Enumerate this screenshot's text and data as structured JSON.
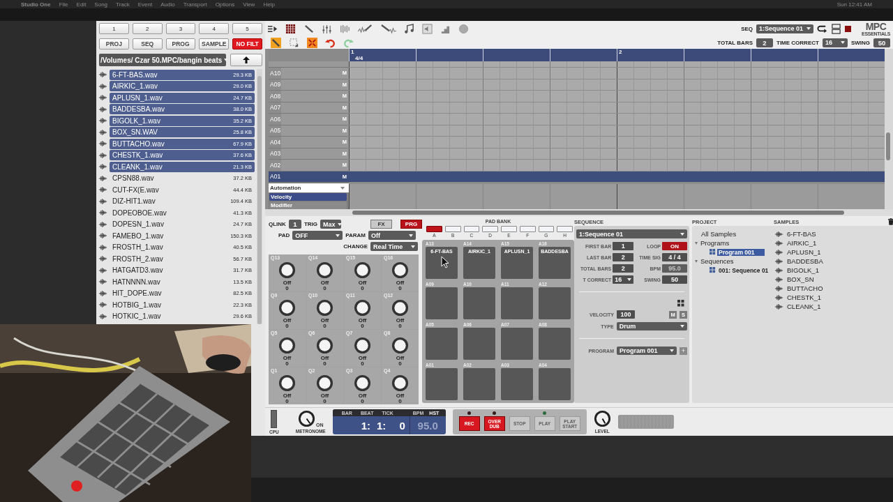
{
  "menubar": {
    "items": [
      "Studio One",
      "File",
      "Edit",
      "Song",
      "Track",
      "Event",
      "Audio",
      "Transport",
      "Options",
      "View",
      "Help"
    ],
    "clock": "Sun 12:41 AM"
  },
  "bank_buttons": [
    "1",
    "2",
    "3",
    "4",
    "5"
  ],
  "mode_buttons": [
    {
      "label": "PROJ",
      "on": false
    },
    {
      "label": "SEQ",
      "on": false
    },
    {
      "label": "PROG",
      "on": false
    },
    {
      "label": "SAMPLE",
      "on": false
    },
    {
      "label": "NO FILT",
      "on": true
    }
  ],
  "browser": {
    "path": "/Volumes/ Czar 50.MPC/bangin beats",
    "files": [
      {
        "name": "6-FT-BAS.wav",
        "size": "29.3 KB",
        "selected": true
      },
      {
        "name": "AIRKIC_1.wav",
        "size": "29.0 KB",
        "selected": true
      },
      {
        "name": "APLUSN_1.wav",
        "size": "24.7 KB",
        "selected": true
      },
      {
        "name": "BADDESBA.wav",
        "size": "38.0 KB",
        "selected": true
      },
      {
        "name": "BIGOLK_1.wav",
        "size": "35.2 KB",
        "selected": true
      },
      {
        "name": "BOX_SN.WAV",
        "size": "25.8 KB",
        "selected": true
      },
      {
        "name": "BUTTACHO.wav",
        "size": "67.9 KB",
        "selected": true
      },
      {
        "name": "CHESTK_1.wav",
        "size": "37.6 KB",
        "selected": true
      },
      {
        "name": "CLEANK_1.wav",
        "size": "21.3 KB",
        "selected": true
      },
      {
        "name": "CPSN88.wav",
        "size": "37.2 KB",
        "selected": false
      },
      {
        "name": "CUT-FX(E.wav",
        "size": "44.4 KB",
        "selected": false
      },
      {
        "name": "DIZ-HIT1.wav",
        "size": "109.4 KB",
        "selected": false
      },
      {
        "name": "DOPEOBOE.wav",
        "size": "41.3 KB",
        "selected": false
      },
      {
        "name": "DOPESN_1.wav",
        "size": "24.7 KB",
        "selected": false
      },
      {
        "name": "FAMEBO_1.wav",
        "size": "150.3 KB",
        "selected": false
      },
      {
        "name": "FROSTH_1.wav",
        "size": "40.5 KB",
        "selected": false
      },
      {
        "name": "FROSTH_2.wav",
        "size": "56.7 KB",
        "selected": false
      },
      {
        "name": "HATGATD3.wav",
        "size": "31.7 KB",
        "selected": false
      },
      {
        "name": "HATNNNN.wav",
        "size": "13.5 KB",
        "selected": false
      },
      {
        "name": "HIT_DOPE.wav",
        "size": "82.5 KB",
        "selected": false
      },
      {
        "name": "HOTBIG_1.wav",
        "size": "22.3 KB",
        "selected": false
      },
      {
        "name": "HOTKIC_1.wav",
        "size": "29.6 KB",
        "selected": false
      }
    ]
  },
  "toolbar": {
    "seq_label": "SEQ",
    "sequence": "1:Sequence 01",
    "logo_title": "MPC",
    "logo_subtitle": "ESSENTIALS",
    "total_bars_label": "TOTAL BARS",
    "total_bars": "2",
    "time_correct_label": "TIME CORRECT",
    "time_correct": "16",
    "swing_label": "SWING",
    "swing": "50"
  },
  "ruler": [
    {
      "bar": "1",
      "time_sig": "4/4"
    },
    {
      "bar": "2"
    }
  ],
  "tracks": [
    {
      "name": "A10",
      "mute": "M",
      "selected": false
    },
    {
      "name": "A09",
      "mute": "M",
      "selected": false
    },
    {
      "name": "A08",
      "mute": "M",
      "selected": false
    },
    {
      "name": "A07",
      "mute": "M",
      "selected": false
    },
    {
      "name": "A06",
      "mute": "M",
      "selected": false
    },
    {
      "name": "A05",
      "mute": "M",
      "selected": false
    },
    {
      "name": "A04",
      "mute": "M",
      "selected": false
    },
    {
      "name": "A03",
      "mute": "M",
      "selected": false
    },
    {
      "name": "A02",
      "mute": "M",
      "selected": false
    },
    {
      "name": "A01",
      "mute": "M",
      "selected": true
    }
  ],
  "automation": {
    "label": "Automation",
    "lanes": [
      {
        "label": "Velocity",
        "selected": true
      },
      {
        "label": "Modifier",
        "selected": false
      }
    ]
  },
  "qlink": {
    "qlink_label": "QLINK",
    "qlink": "1",
    "trig_label": "TRIG",
    "trig": "Max",
    "pad_label": "PAD",
    "pad": "OFF",
    "fx": {
      "label": "FX",
      "on": false
    },
    "prg": {
      "label": "PRG",
      "on": true
    },
    "param_label": "PARAM",
    "param": "Off",
    "change_label": "CHANGE",
    "change": "Real Time",
    "knobs": [
      {
        "name": "Q13",
        "value": "Off",
        "number": "0"
      },
      {
        "name": "Q14",
        "value": "Off",
        "number": "0"
      },
      {
        "name": "Q15",
        "value": "Off",
        "number": "0"
      },
      {
        "name": "Q16",
        "value": "Off",
        "number": "0"
      },
      {
        "name": "Q9",
        "value": "Off",
        "number": "0"
      },
      {
        "name": "Q10",
        "value": "Off",
        "number": "0"
      },
      {
        "name": "Q11",
        "value": "Off",
        "number": "0"
      },
      {
        "name": "Q12",
        "value": "Off",
        "number": "0"
      },
      {
        "name": "Q5",
        "value": "Off",
        "number": "0"
      },
      {
        "name": "Q6",
        "value": "Off",
        "number": "0"
      },
      {
        "name": "Q7",
        "value": "Off",
        "number": "0"
      },
      {
        "name": "Q8",
        "value": "Off",
        "number": "0"
      },
      {
        "name": "Q1",
        "value": "Off",
        "number": "0"
      },
      {
        "name": "Q2",
        "value": "Off",
        "number": "0"
      },
      {
        "name": "Q3",
        "value": "Off",
        "number": "0"
      },
      {
        "name": "Q4",
        "value": "Off",
        "number": "0"
      }
    ]
  },
  "pad_bank": {
    "title": "PAD BANK",
    "banks": [
      {
        "letter": "A",
        "selected": true
      },
      {
        "letter": "B",
        "selected": false
      },
      {
        "letter": "C",
        "selected": false
      },
      {
        "letter": "D",
        "selected": false
      },
      {
        "letter": "E",
        "selected": false
      },
      {
        "letter": "F",
        "selected": false
      },
      {
        "letter": "G",
        "selected": false
      },
      {
        "letter": "H",
        "selected": false
      }
    ],
    "pads": [
      {
        "name": "A13",
        "sample": "6-FT-BAS"
      },
      {
        "name": "A14",
        "sample": "AIRKIC_1"
      },
      {
        "name": "A15",
        "sample": "APLUSN_1"
      },
      {
        "name": "A16",
        "sample": "BADDESBA"
      },
      {
        "name": "A09"
      },
      {
        "name": "A10"
      },
      {
        "name": "A11"
      },
      {
        "name": "A12"
      },
      {
        "name": "A05"
      },
      {
        "name": "A06"
      },
      {
        "name": "A07"
      },
      {
        "name": "A08"
      },
      {
        "name": "A01"
      },
      {
        "name": "A02"
      },
      {
        "name": "A03"
      },
      {
        "name": "A04"
      }
    ]
  },
  "sequence": {
    "title": "SEQUENCE",
    "name": "1:Sequence 01",
    "fields": [
      {
        "label": "FIRST BAR",
        "value": "1",
        "kind": "value"
      },
      {
        "label": "LOOP",
        "value": "ON",
        "kind": "toggle"
      },
      {
        "label": "LAST BAR",
        "value": "2",
        "kind": "value"
      },
      {
        "label": "TIME SIG",
        "value": "4 / 4",
        "kind": "value"
      },
      {
        "label": "TOTAL BARS",
        "value": "2",
        "kind": "value"
      },
      {
        "label": "BPM",
        "value": "95.0",
        "kind": "disabled"
      },
      {
        "label": "T CORRECT",
        "value": "16",
        "kind": "select"
      },
      {
        "label": "SWING",
        "value": "50",
        "kind": "value"
      }
    ],
    "velocity_label": "VELOCITY",
    "velocity": "100",
    "mute": "M",
    "solo": "S",
    "type_label": "TYPE",
    "type": "Drum",
    "program_label": "PROGRAM",
    "program": "Program 001",
    "add": "+"
  },
  "project": {
    "title": "PROJECT",
    "tree": [
      {
        "label": "All Samples",
        "selected": false
      },
      {
        "label": "Programs",
        "expanded": true,
        "selected": false,
        "children": [
          {
            "label": "Program 001",
            "selected": true
          }
        ]
      },
      {
        "label": "Sequences",
        "expanded": true,
        "selected": false,
        "children": [
          {
            "label": "001: Sequence 01",
            "selected": false
          }
        ]
      }
    ]
  },
  "samples": {
    "title": "SAMPLES",
    "items": [
      "6-FT-BAS",
      "AIRKIC_1",
      "APLUSN_1",
      "BADDESBA",
      "BIGOLK_1",
      "BOX_SN",
      "BUTTACHO",
      "CHESTK_1",
      "CLEANK_1"
    ]
  },
  "transport": {
    "cpu_label": "CPU",
    "metronome_label": "METRONOME",
    "metronome_state": "ON",
    "columns": [
      "BAR",
      "BEAT",
      "TICK"
    ],
    "bar": "1:",
    "beat": "1:",
    "tick": "0",
    "bpm_label": "BPM",
    "hst": "HST",
    "bpm": "95.0",
    "buttons": [
      {
        "label": "REC",
        "on": true
      },
      {
        "label": "OVER DUB",
        "on": true
      },
      {
        "label": "STOP",
        "on": false
      },
      {
        "label": "PLAY",
        "on": false
      },
      {
        "label": "PLAY START",
        "on": false
      }
    ],
    "level_label": "LEVEL"
  }
}
